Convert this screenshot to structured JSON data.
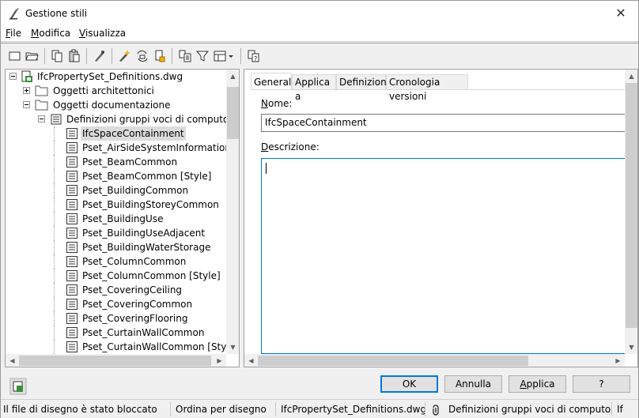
{
  "window": {
    "title": "Gestione stili",
    "close_glyph": "✕"
  },
  "menu": [
    {
      "label": "File",
      "mnemonic": "F",
      "rest": "ile"
    },
    {
      "label": "Modifica",
      "mnemonic": "M",
      "rest": "odifica"
    },
    {
      "label": "Visualizza",
      "mnemonic": "V",
      "rest": "isualizza"
    }
  ],
  "toolbar": {
    "icons": [
      "new-drawing-icon",
      "open-drawing-icon",
      "copy-icon",
      "paste-icon",
      "purge-icon",
      "new-style-icon",
      "synchronize-icon",
      "edit-style-icon",
      "toggle-view-icon",
      "filter-icon",
      "view-options-icon",
      "help-icon"
    ]
  },
  "tree": {
    "root": "IfcPropertySet_Definitions.dwg",
    "folders": [
      "Oggetti architettonici",
      "Oggetti documentazione"
    ],
    "category": "Definizioni gruppi voci di computo",
    "items": [
      "IfcSpaceContainment",
      "Pset_AirSideSystemInformation",
      "Pset_BeamCommon",
      "Pset_BeamCommon [Style]",
      "Pset_BuildingCommon",
      "Pset_BuildingStoreyCommon",
      "Pset_BuildingUse",
      "Pset_BuildingUseAdjacent",
      "Pset_BuildingWaterStorage",
      "Pset_ColumnCommon",
      "Pset_ColumnCommon [Style]",
      "Pset_CoveringCeiling",
      "Pset_CoveringCommon",
      "Pset_CoveringFlooring",
      "Pset_CurtainWallCommon",
      "Pset_CurtainWallCommon [Style]"
    ],
    "selected_index": 0
  },
  "tabs": [
    "Generale",
    "Applica a",
    "Definizione",
    "Cronologia versioni"
  ],
  "active_tab": 0,
  "general": {
    "name_label": "Nome:",
    "name_mnemonic": "N",
    "name_rest": "ome:",
    "name_value": "IfcSpaceContainment",
    "description_label": "Descrizione:",
    "description_mnemonic": "D",
    "description_rest": "escrizione:",
    "description_value": ""
  },
  "buttons": {
    "ok": "OK",
    "cancel": "Annulla",
    "apply": "Applica",
    "apply_mnemonic": "A",
    "apply_rest": "pplica",
    "help": "?"
  },
  "status": {
    "lock_state": "Il file di disegno è stato bloccato",
    "sort": "Ordina per disegno",
    "file": "IfcPropertySet_Definitions.dwg",
    "category": "Definizioni gruppi voci di computo",
    "item": "If"
  },
  "colors": {
    "accent": "#0078d7",
    "selection": "#dcdcdc"
  }
}
